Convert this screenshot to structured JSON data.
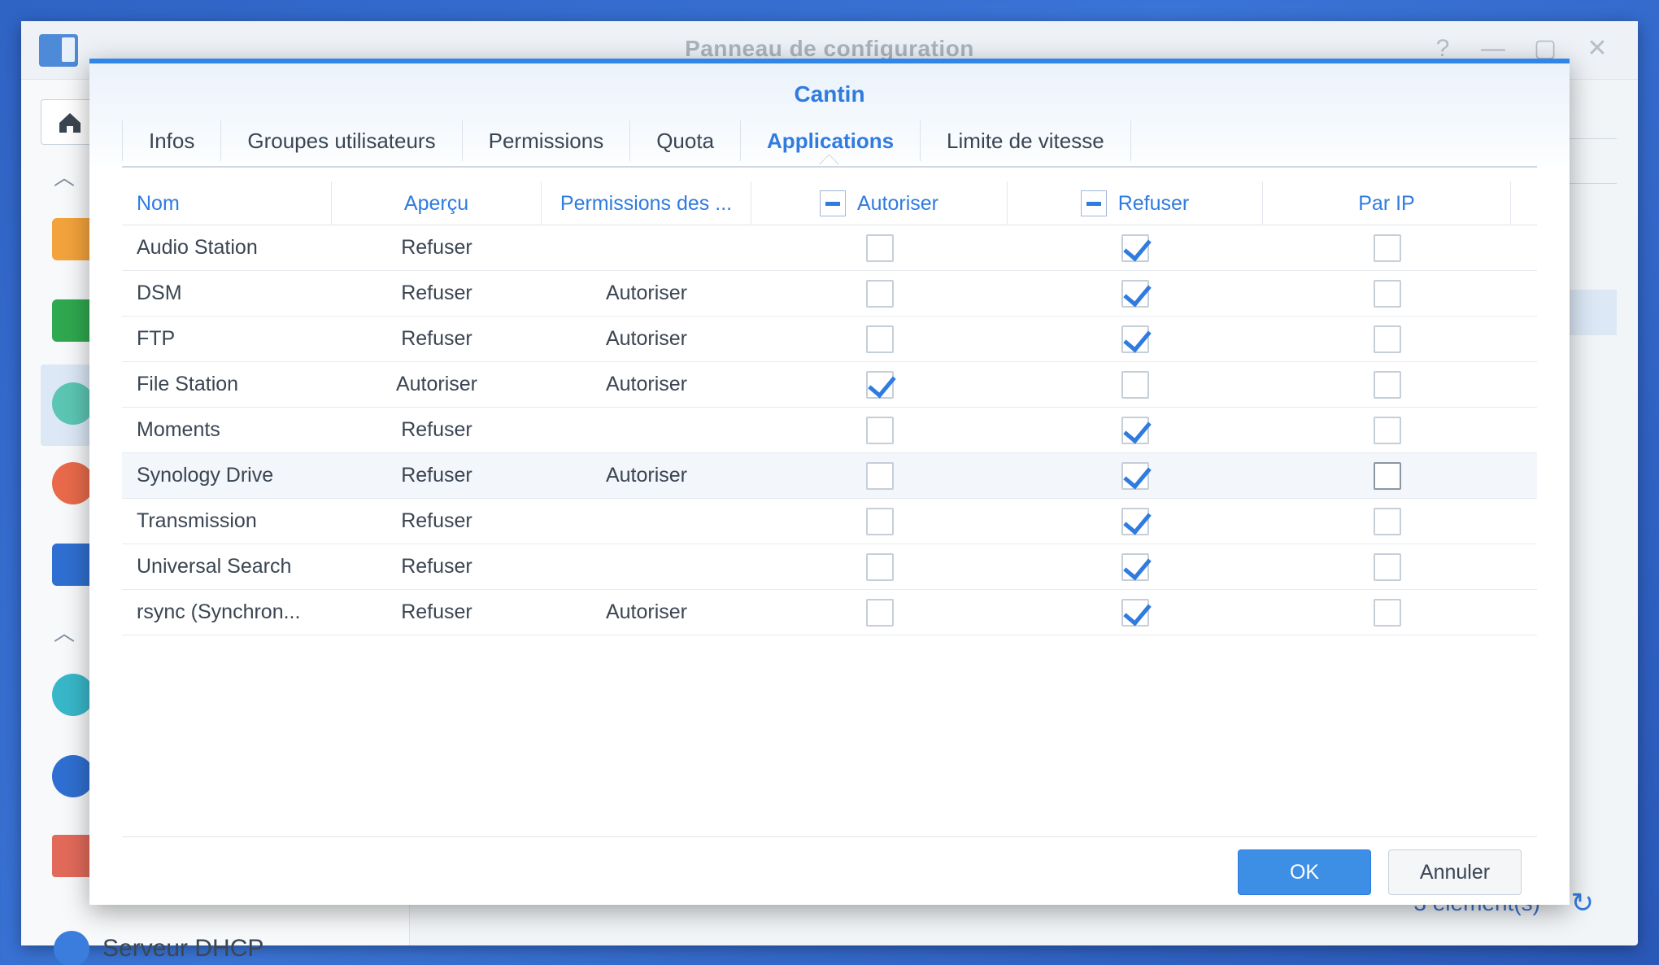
{
  "background_window": {
    "title": "Panneau de configuration",
    "sidebar_bottom_label": "Serveur DHCP",
    "footer_text": "3 élément(s)",
    "controls": {
      "help": "?",
      "minimize": "—",
      "maximize": "▢",
      "close": "✕"
    }
  },
  "dialog": {
    "title": "Cantin",
    "tabs": [
      {
        "label": "Infos"
      },
      {
        "label": "Groupes utilisateurs"
      },
      {
        "label": "Permissions"
      },
      {
        "label": "Quota"
      },
      {
        "label": "Applications"
      },
      {
        "label": "Limite de vitesse"
      }
    ],
    "active_tab": "Applications",
    "columns": {
      "name": "Nom",
      "preview": "Aperçu",
      "group_permissions": "Permissions des ...",
      "allow": "Autoriser",
      "deny": "Refuser",
      "by_ip": "Par IP"
    },
    "rows": [
      {
        "name": "Audio Station",
        "preview": "Refuser",
        "group": "",
        "allow": false,
        "deny": true,
        "by_ip": false
      },
      {
        "name": "DSM",
        "preview": "Refuser",
        "group": "Autoriser",
        "allow": false,
        "deny": true,
        "by_ip": false
      },
      {
        "name": "FTP",
        "preview": "Refuser",
        "group": "Autoriser",
        "allow": false,
        "deny": true,
        "by_ip": false
      },
      {
        "name": "File Station",
        "preview": "Autoriser",
        "group": "Autoriser",
        "allow": true,
        "deny": false,
        "by_ip": false
      },
      {
        "name": "Moments",
        "preview": "Refuser",
        "group": "",
        "allow": false,
        "deny": true,
        "by_ip": false
      },
      {
        "name": "Synology Drive",
        "preview": "Refuser",
        "group": "Autoriser",
        "allow": false,
        "deny": true,
        "by_ip": false
      },
      {
        "name": "Transmission",
        "preview": "Refuser",
        "group": "",
        "allow": false,
        "deny": true,
        "by_ip": false
      },
      {
        "name": "Universal Search",
        "preview": "Refuser",
        "group": "",
        "allow": false,
        "deny": true,
        "by_ip": false
      },
      {
        "name": "rsync (Synchron...",
        "preview": "Refuser",
        "group": "Autoriser",
        "allow": false,
        "deny": true,
        "by_ip": false
      }
    ],
    "buttons": {
      "ok": "OK",
      "cancel": "Annuler"
    }
  },
  "colors": {
    "accent": "#2f7be0",
    "desktop": "#3a74d6"
  }
}
